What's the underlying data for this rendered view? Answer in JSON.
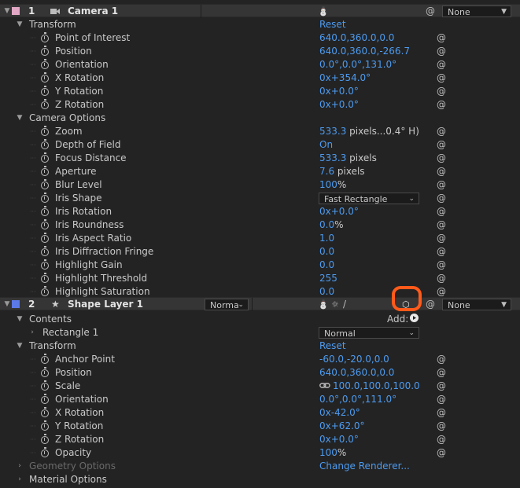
{
  "colors": {
    "camera_label": "#e2a7c5",
    "shape_label": "#5c79e8",
    "value_blue": "#4d9bf0",
    "highlight_circle": "#ff5a1a"
  },
  "camera_layer": {
    "number": "1",
    "name": "Camera 1",
    "parent": "None",
    "transform": {
      "label": "Transform",
      "reset": "Reset",
      "props": [
        {
          "name": "Point of Interest",
          "value": "640.0,360.0,0.0"
        },
        {
          "name": "Position",
          "value": "640.0,360.0,-266.7"
        },
        {
          "name": "Orientation",
          "value": "0.0°,0.0°,131.0°"
        },
        {
          "name": "X Rotation",
          "prefix": "0x",
          "value": "+354.0°"
        },
        {
          "name": "Y Rotation",
          "prefix": "0x",
          "value": "+0.0°"
        },
        {
          "name": "Z Rotation",
          "prefix": "0x",
          "value": "+0.0°"
        }
      ]
    },
    "camera_options": {
      "label": "Camera Options",
      "props": [
        {
          "name": "Zoom",
          "value": "533.3",
          "unit": " pixels...0.4° H)"
        },
        {
          "name": "Depth of Field",
          "value": "On"
        },
        {
          "name": "Focus Distance",
          "value": "533.3",
          "unit": " pixels"
        },
        {
          "name": "Aperture",
          "value": "7.6",
          "unit": " pixels"
        },
        {
          "name": "Blur Level",
          "value": "100",
          "unit": "%"
        },
        {
          "name": "Iris Shape",
          "dropdown": "Fast Rectangle"
        },
        {
          "name": "Iris Rotation",
          "prefix": "0x",
          "value": "+0.0°"
        },
        {
          "name": "Iris Roundness",
          "value": "0.0",
          "unit": "%"
        },
        {
          "name": "Iris Aspect Ratio",
          "value": "1.0"
        },
        {
          "name": "Iris Diffraction Fringe",
          "value": "0.0"
        },
        {
          "name": "Highlight Gain",
          "value": "0.0"
        },
        {
          "name": "Highlight Threshold",
          "value": "255"
        },
        {
          "name": "Highlight Saturation",
          "value": "0.0"
        }
      ]
    }
  },
  "shape_layer": {
    "number": "2",
    "name": "Shape Layer 1",
    "mode": "Norma",
    "parent": "None",
    "contents": {
      "label": "Contents",
      "add_label": "Add:",
      "rectangle": "Rectangle 1",
      "blend_mode": "Normal"
    },
    "transform": {
      "label": "Transform",
      "reset": "Reset",
      "props": [
        {
          "name": "Anchor Point",
          "value": "-60.0,-20.0,0.0"
        },
        {
          "name": "Position",
          "value": "640.0,360.0,0.0"
        },
        {
          "name": "Scale",
          "value": "100.0,100.0,100.0"
        },
        {
          "name": "Orientation",
          "value": "0.0°,0.0°,111.0°"
        },
        {
          "name": "X Rotation",
          "prefix": "0x",
          "value": "-42.0°"
        },
        {
          "name": "Y Rotation",
          "prefix": "0x",
          "value": "+62.0°"
        },
        {
          "name": "Z Rotation",
          "prefix": "0x",
          "value": "+0.0°"
        },
        {
          "name": "Opacity",
          "value": "100",
          "unit": "%"
        }
      ]
    },
    "geometry_options": {
      "label": "Geometry Options",
      "link": "Change Renderer..."
    },
    "material_options": {
      "label": "Material Options"
    }
  }
}
